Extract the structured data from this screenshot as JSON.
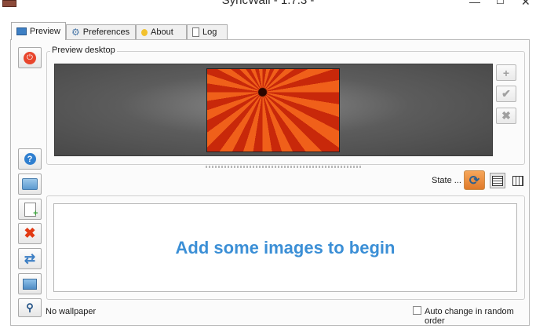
{
  "window": {
    "title": "SyncWall - 1.7.3 -",
    "minimize": "—",
    "close": "✕"
  },
  "tabs": [
    {
      "label": "Preview",
      "icon": "monitor-icon"
    },
    {
      "label": "Preferences",
      "icon": "gear-icon"
    },
    {
      "label": "About",
      "icon": "lightbulb-icon"
    },
    {
      "label": "Log",
      "icon": "document-icon"
    }
  ],
  "toolbar": {
    "power": "power-icon",
    "help": "help-icon",
    "open_folder": "folder-icon",
    "add_file": "add-file-icon",
    "remove": "remove-icon",
    "sync": "sync-icon",
    "set_wallpaper": "monitor-icon",
    "view": "magnifier-icon"
  },
  "preview": {
    "group_label": "Preview desktop",
    "buttons": {
      "add": "+",
      "apply": "✔",
      "remove": "✖"
    }
  },
  "state": {
    "label": "State ..."
  },
  "list": {
    "empty_message": "Add some images to begin"
  },
  "status": {
    "text": "No wallpaper"
  },
  "options": {
    "random_order_label": "Auto change in random order",
    "random_order_checked": false
  },
  "colors": {
    "accent_text": "#3b8fd6",
    "power_button": "#e8452c",
    "remove_icon": "#e23a14",
    "state_icon": "#f08a3a"
  }
}
